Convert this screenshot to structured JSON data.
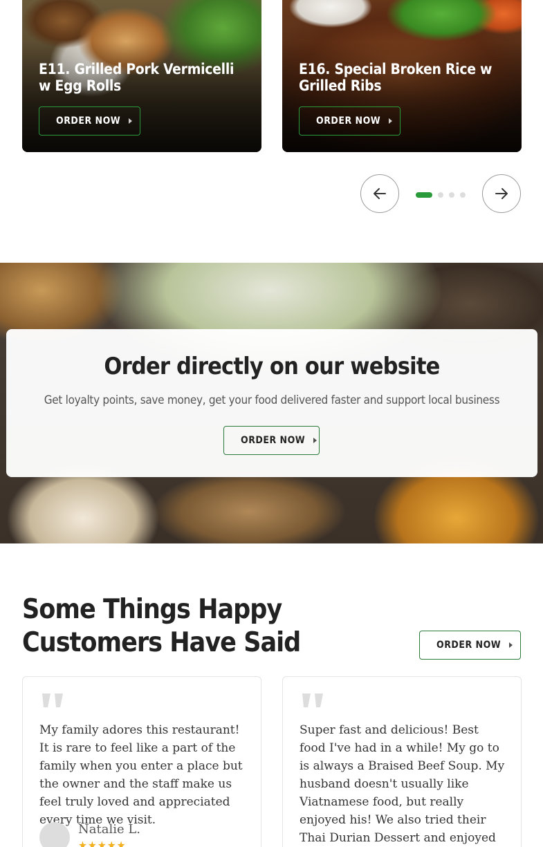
{
  "carousel": {
    "cards": [
      {
        "title": "E11. Grilled Pork Vermicelli w Egg Rolls",
        "button": "ORDER NOW"
      },
      {
        "title": "E16. Special Broken Rice w Grilled Ribs",
        "button": "ORDER NOW"
      }
    ],
    "page_count": 4,
    "active_page": 1
  },
  "banner": {
    "title": "Order directly on our website",
    "subtitle": "Get loyalty points, save money, get your food delivered faster and support local business",
    "button": "ORDER NOW"
  },
  "testimonials": {
    "title": "Some Things Happy Customers Have Said",
    "button": "ORDER NOW",
    "reviews": [
      {
        "text": "My family adores this restaurant! It is rare to feel like a part of the family when you enter a place but the owner and the staff make us feel truly loved and appreciated every time we visit.",
        "author": "Natalie L.",
        "stars": "★★★★★"
      },
      {
        "text": "Super fast and delicious! Best food I've had in a while! My go to is always a Braised Beef Soup. My husband doesn't usually like Viatnamese food, but really enjoyed his! We also tried their Thai Durian Dessert and enjoyed it too! Definitely coming back here!"
      }
    ]
  },
  "colors": {
    "accent": "#2a9a3a",
    "star": "#f2b01e"
  }
}
